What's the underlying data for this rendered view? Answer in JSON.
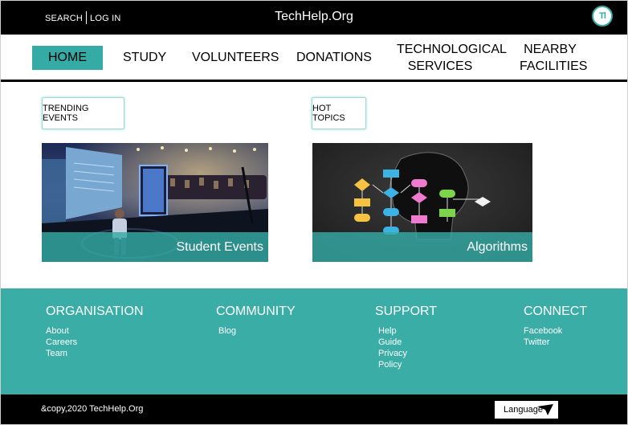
{
  "header": {
    "search_label": "SEARCH",
    "login_label": "LOG IN",
    "site_title": "TechHelp.Org",
    "logo_text": "Tl"
  },
  "nav": {
    "home": "HOME",
    "study": "STUDY",
    "volunteers": "VOLUNTEERS",
    "donations": "DONATIONS",
    "tech_services_line1": "TECHNOLOGICAL",
    "tech_services_line2": "SERVICES",
    "nearby_line1": "NEARBY",
    "nearby_line2": "FACILITIES"
  },
  "sections": {
    "trending_label": "TRENDING EVENTS",
    "hot_topics_label": "HOT TOPICS"
  },
  "cards": {
    "student_events": "Student Events",
    "algorithms": "Algorithms"
  },
  "footer": {
    "organisation": {
      "title": "ORGANISATION",
      "links": [
        "About",
        "Careers",
        "Team"
      ]
    },
    "community": {
      "title": "COMMUNITY",
      "links": [
        "Blog"
      ]
    },
    "support": {
      "title": "SUPPORT",
      "links": [
        "Help",
        "Guide",
        "Privacy",
        "Policy"
      ]
    },
    "connect": {
      "title": "CONNECT",
      "links": [
        "Facebook",
        "Twitter"
      ]
    }
  },
  "bottom": {
    "copyright": "&copy,2020 TechHelp.Org",
    "language_label": "Language"
  },
  "colors": {
    "accent": "#35aba5",
    "dark": "#000000",
    "footer_bg": "#3aada6"
  }
}
